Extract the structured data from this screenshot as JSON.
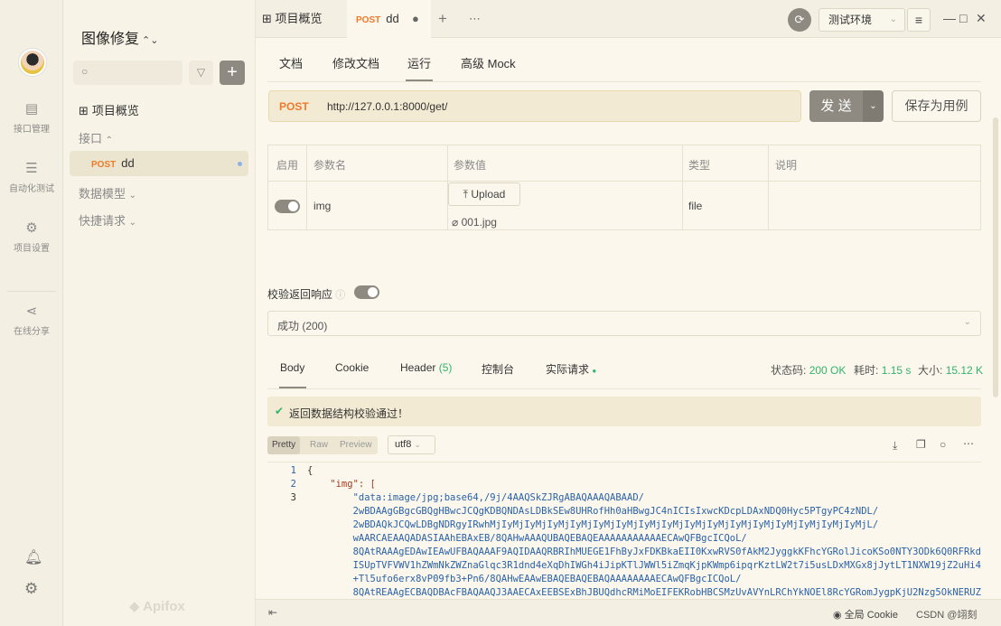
{
  "rail": {
    "items": [
      {
        "label": "接口管理",
        "icon": "api-icon"
      },
      {
        "label": "自动化测试",
        "icon": "automation-icon"
      },
      {
        "label": "项目设置",
        "icon": "project-settings-icon"
      },
      {
        "label": "在线分享",
        "icon": "share-icon"
      }
    ]
  },
  "sidebar": {
    "project_title": "图像修复",
    "overview": "项目概览",
    "interfaces": "接口",
    "endpoint_method": "POST",
    "endpoint_name": "dd",
    "data_models": "数据模型",
    "quick_requests": "快捷请求",
    "brand": "Apifox"
  },
  "topbar": {
    "tab_overview": "项目概览",
    "tab_method": "POST",
    "tab_name": "dd",
    "env": "测试环境"
  },
  "subtabs": [
    "文档",
    "修改文档",
    "运行",
    "高级 Mock"
  ],
  "request": {
    "method": "POST",
    "url": "http://127.0.0.1:8000/get/",
    "send": "发 送",
    "save_case": "保存为用例"
  },
  "params": {
    "headers": [
      "启用",
      "参数名",
      "参数值",
      "类型",
      "说明"
    ],
    "row": {
      "name": "img",
      "upload": "Upload",
      "file": "001.jpg",
      "type": "file"
    }
  },
  "validation": {
    "label": "校验返回响应",
    "selected": "成功 (200)"
  },
  "response": {
    "tabs": [
      "Body",
      "Cookie",
      "Header",
      "控制台",
      "实际请求"
    ],
    "header_count": "(5)",
    "status_label": "状态码:",
    "status_value": "200 OK",
    "time_label": "耗时:",
    "time_value": "1.15 s",
    "size_label": "大小:",
    "size_value": "15.12 K",
    "pass_msg": "返回数据结构校验通过！",
    "formats": [
      "Pretty",
      "Raw",
      "Preview"
    ],
    "encoding": "utf8"
  },
  "code": {
    "line_numbers": [
      "1",
      "2",
      "3"
    ],
    "lines": [
      "{",
      "    \"img\": [",
      "        \"data:image/jpg;base64,/9j/4AAQSkZJRgABAQAAAQABAAD/",
      "        2wBDAAgGBgcGBQgHBwcJCQgKDBQNDAsLDBkSEw8UHRofHh0aHBwgJC4nICIsIxwcKDcpLDAxNDQ0Hyc5PTgyPC4zNDL/",
      "        2wBDAQkJCQwLDBgNDRgyIRwhMjIyMjIyMjIyMjIyMjIyMjIyMjIyMjIyMjIyMjIyMjIyMjIyMjIyMjIyMjIyMjIyMjL/",
      "        wAARCAEAAQADASIAAhEBAxEB/8QAHwAAAQUBAQEBAQEAAAAAAAAAAAECAwQFBgcICQoL/",
      "        8QAtRAAAgEDAwIEAwUFBAQAAAF9AQIDAAQRBRIhMUEGE1FhByJxFDKBkaEII0KxwRVS0fAkM2JyggkKFhcYGRolJicoKSo0NTY3ODk6Q0RFRkd",
      "        ISUpTVFVWV1hZWmNkZWZnaGlqc3R1dnd4eXqDhIWGh4iJipKTlJWWl5iZmqKjpKWmp6ipqrKztLW2t7i5usLDxMXGx8jJytLT1NXW19jZ2uHi4",
      "        +Tl5ufo6erx8vP09fb3+Pn6/8QAHwEAAwEBAQEBAQEBAQAAAAAAAAECAwQFBgcICQoL/",
      "        8QAtREAAgECBAQDBAcFBAQAAQJ3AAECAxEEBSExBhJBUQdhcRMiMoEIFEKRobHBCSMzUvAVYnLRChYkNOEl8RcYGRomJygpKjU2Nzg5OkNERUZ"
    ]
  },
  "statusbar": {
    "cookie": "全局 Cookie",
    "watermark": "CSDN @翊刻"
  }
}
